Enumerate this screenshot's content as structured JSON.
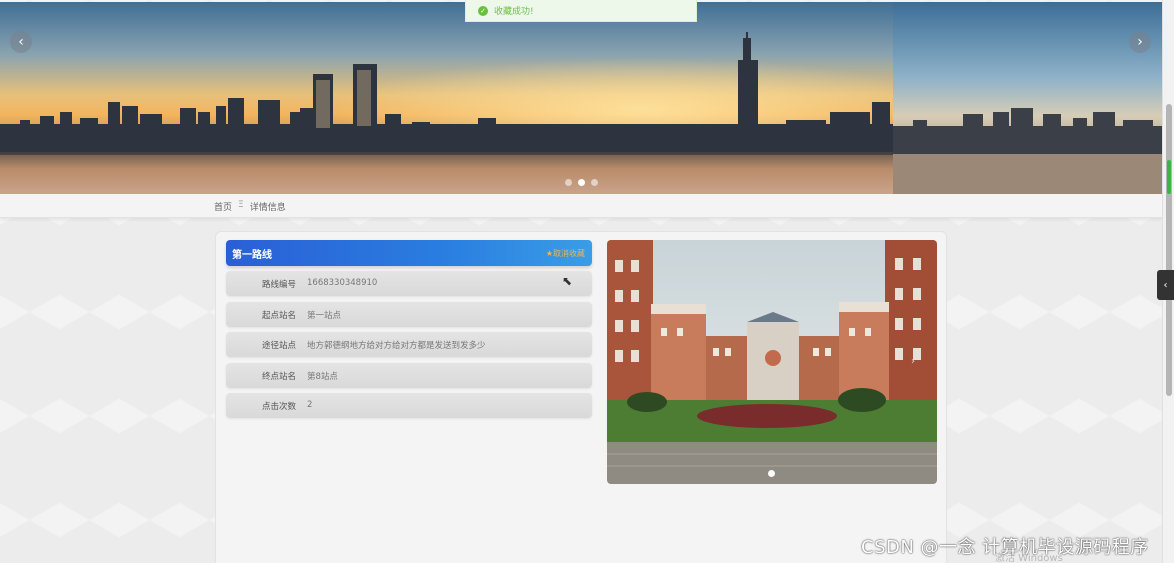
{
  "toast": {
    "message": "收藏成功!",
    "icon": "check-circle-icon",
    "color": "#67c23a"
  },
  "banner": {
    "prev_icon": "‹",
    "next_icon": "›",
    "slides_count": 3,
    "active_slide": 2
  },
  "breadcrumb": {
    "home": "首页",
    "separator": "Ξ",
    "current": "详情信息"
  },
  "detail": {
    "title": "第一路线",
    "favorite_button": "★取消收藏",
    "fields": [
      {
        "label": "路线编号",
        "value": "1668330348910"
      },
      {
        "label": "起点站名",
        "value": "第一站点"
      },
      {
        "label": "途径站点",
        "value": "地方郭德纲地方给对方给对方都是发送到发多少"
      },
      {
        "label": "终点站名",
        "value": "第8站点"
      },
      {
        "label": "点击次数",
        "value": "2"
      }
    ]
  },
  "gallery": {
    "next_icon": "›",
    "slides_count": 1
  },
  "side_tab": {
    "icon": "‹"
  },
  "watermark": "CSDN @一念 计算机毕设源码程序",
  "os_notice": "激活 Windows",
  "colors": {
    "accent": "#2a6fdc",
    "favorite": "#f0b54a",
    "success": "#67c23a"
  }
}
